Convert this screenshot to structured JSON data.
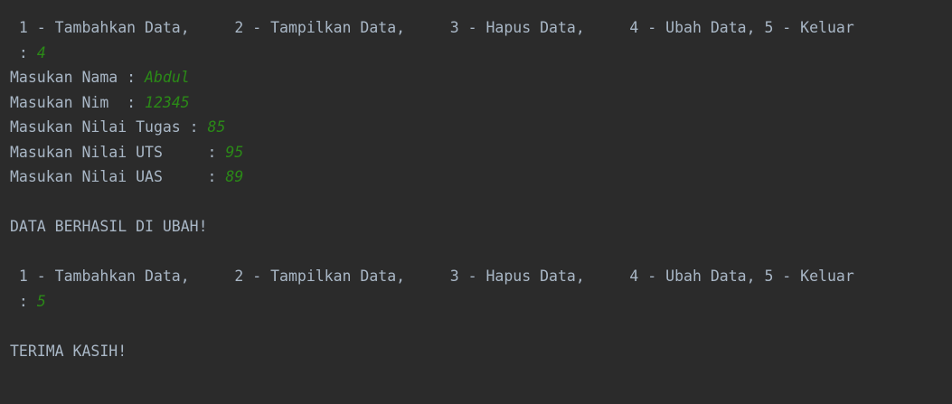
{
  "console": {
    "menu_prompt_1": " 1 - Tambahkan Data,     2 - Tampilkan Data,     3 - Hapus Data,     4 - Ubah Data, 5 - Keluar",
    "choice_label_1": " : ",
    "choice_value_1": "4",
    "nama_label": "Masukan Nama : ",
    "nama_value": "Abdul",
    "nim_label": "Masukan Nim  : ",
    "nim_value": "12345",
    "tugas_label": "Masukan Nilai Tugas : ",
    "tugas_value": "85",
    "uts_label": "Masukan Nilai UTS     : ",
    "uts_value": "95",
    "uas_label": "Masukan Nilai UAS     : ",
    "uas_value": "89",
    "update_message": "DATA BERHASIL DI UBAH!",
    "menu_prompt_2": " 1 - Tambahkan Data,     2 - Tampilkan Data,     3 - Hapus Data,     4 - Ubah Data, 5 - Keluar",
    "choice_label_2": " : ",
    "choice_value_2": "5",
    "exit_message": "TERIMA KASIH!"
  },
  "colors": {
    "background": "#2b2b2b",
    "output_text": "#a9b7c6",
    "user_input": "#2b8a17"
  }
}
